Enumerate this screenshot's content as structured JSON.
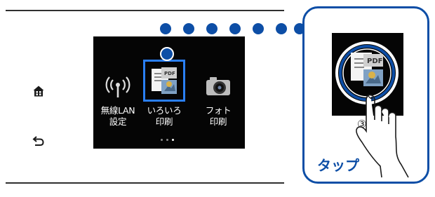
{
  "nav": {
    "home_icon": "home-icon",
    "back_icon": "back-icon"
  },
  "menu": {
    "items": [
      {
        "label": "無線LAN\n設定",
        "icon": "wifi-antenna-icon"
      },
      {
        "label": "いろいろ\n印刷",
        "icon": "various-print-icon",
        "selected": true
      },
      {
        "label": "フォト\n印刷",
        "icon": "camera-icon"
      }
    ],
    "page_indicator": {
      "pages": 3,
      "current": 3
    }
  },
  "callout": {
    "step_number": "③",
    "action_label": "タップ",
    "icon_text": "PDF"
  },
  "colors": {
    "accent": "#0d4ea6",
    "selection": "#2a7ff5",
    "screen_bg": "#050505"
  }
}
